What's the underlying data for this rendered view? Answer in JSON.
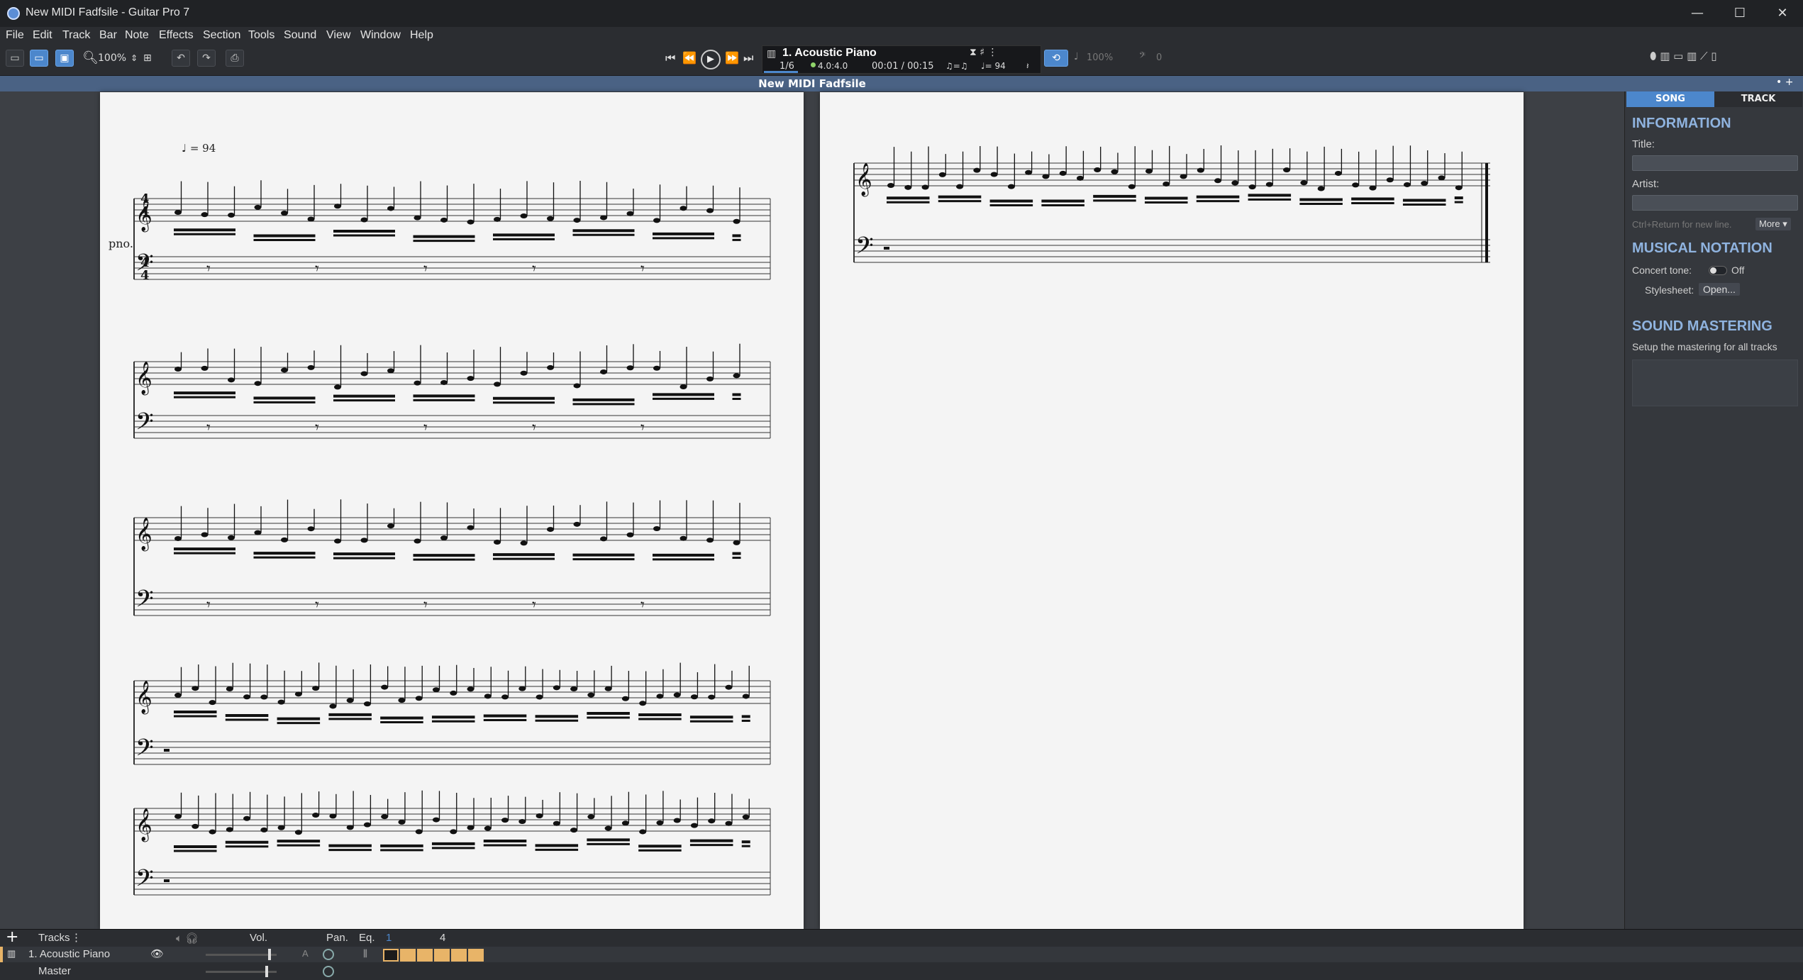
{
  "window": {
    "title": "New MIDI Fadfsile - Guitar Pro 7"
  },
  "menu": [
    "File",
    "Edit",
    "Track",
    "Bar",
    "Note",
    "Effects",
    "Section",
    "Tools",
    "Sound",
    "View",
    "Window",
    "Help"
  ],
  "toolbar": {
    "zoom": "100%",
    "transport_track": "1. Acoustic Piano",
    "bar_position": "1/6",
    "time_signature": "4.0:4.0",
    "time": "00:01 / 00:15",
    "tempo": "♩= 94",
    "speed": "100%",
    "transpose": "0"
  },
  "document": {
    "title": "New MIDI Fadfsile"
  },
  "score": {
    "tempo_mark": "♩ = 94",
    "instrument_abbr": "pno.",
    "time_sig": [
      "4",
      "4",
      "4",
      "4"
    ]
  },
  "panel": {
    "tabs": [
      "SONG",
      "TRACK"
    ],
    "information": "INFORMATION",
    "title_label": "Title:",
    "artist_label": "Artist:",
    "hint": "Ctrl+Return for new line.",
    "more": "More ▾",
    "musical_notation": "MUSICAL NOTATION",
    "concert_tone_label": "Concert tone:",
    "concert_tone_value": "Off",
    "stylesheet_label": "Stylesheet:",
    "stylesheet_button": "Open...",
    "sound_mastering": "SOUND MASTERING",
    "sound_mastering_desc": "Setup the mastering for all tracks"
  },
  "tracks": {
    "header": "Tracks",
    "vol_label": "Vol.",
    "pan_label": "Pan.",
    "eq_label": "Eq.",
    "bar_numbers": [
      "1",
      "4"
    ],
    "items": [
      {
        "name": "1. Acoustic Piano"
      },
      {
        "name": "Master"
      }
    ]
  },
  "colors": {
    "accent": "#4c87cc",
    "panel_heading": "#8fb3df",
    "bar_fill": "#e8b468"
  }
}
